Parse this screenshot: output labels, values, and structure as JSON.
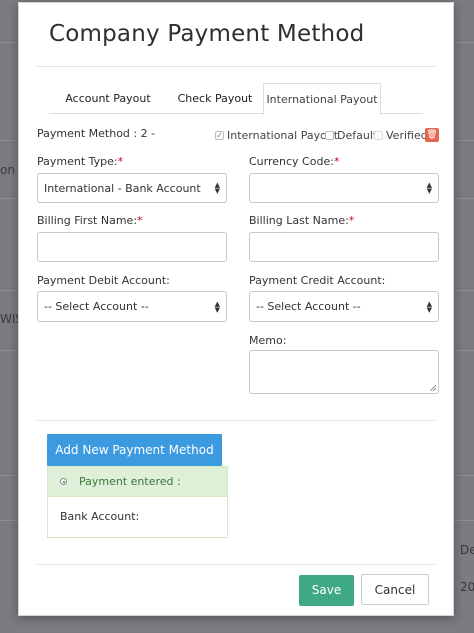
{
  "background": {
    "left_fragment_1": "on T",
    "left_fragment_2": "WIS",
    "right_fragment_1": "De",
    "right_fragment_2": "20"
  },
  "modal": {
    "title": "Company Payment Method",
    "tabs": [
      {
        "label": "Account Payout"
      },
      {
        "label": "Check Payout"
      },
      {
        "label": "International Payout"
      }
    ],
    "active_tab": "International Payout",
    "payment_method_text": "Payment Method : 2 -",
    "options": {
      "international_payout": {
        "label": "International Payout",
        "checked": true
      },
      "default": {
        "label": "Default",
        "checked": false
      },
      "verified": {
        "label": "Verified",
        "checked": false
      }
    },
    "payment_type": {
      "label": "Payment Type:",
      "required": "*",
      "value": "International - Bank Account"
    },
    "currency_code": {
      "label": "Currency Code:",
      "required": "*",
      "value": ""
    },
    "billing_first_name": {
      "label": "Billing First Name:",
      "required": "*",
      "value": ""
    },
    "billing_last_name": {
      "label": "Billing Last Name:",
      "required": "*",
      "value": ""
    },
    "payment_debit_account": {
      "label": "Payment Debit Account:",
      "value": "-- Select Account --"
    },
    "payment_credit_account": {
      "label": "Payment Credit Account:",
      "value": "-- Select Account --"
    },
    "memo": {
      "label": "Memo:",
      "value": ""
    },
    "add_button_label": "Add New Payment Method",
    "panel": {
      "heading": "Payment entered :",
      "bank_account_label": "Bank Account:"
    },
    "footer": {
      "save_label": "Save",
      "cancel_label": "Cancel"
    }
  },
  "colors": {
    "primary_button": "#3c9be0",
    "save_button": "#3fa886",
    "danger_icon": "#e5654f",
    "success_panel": "#dff0d8"
  },
  "icons": {
    "trash": "trash-icon",
    "select_caret": "updown-caret-icon",
    "radio": "radio-icon"
  }
}
